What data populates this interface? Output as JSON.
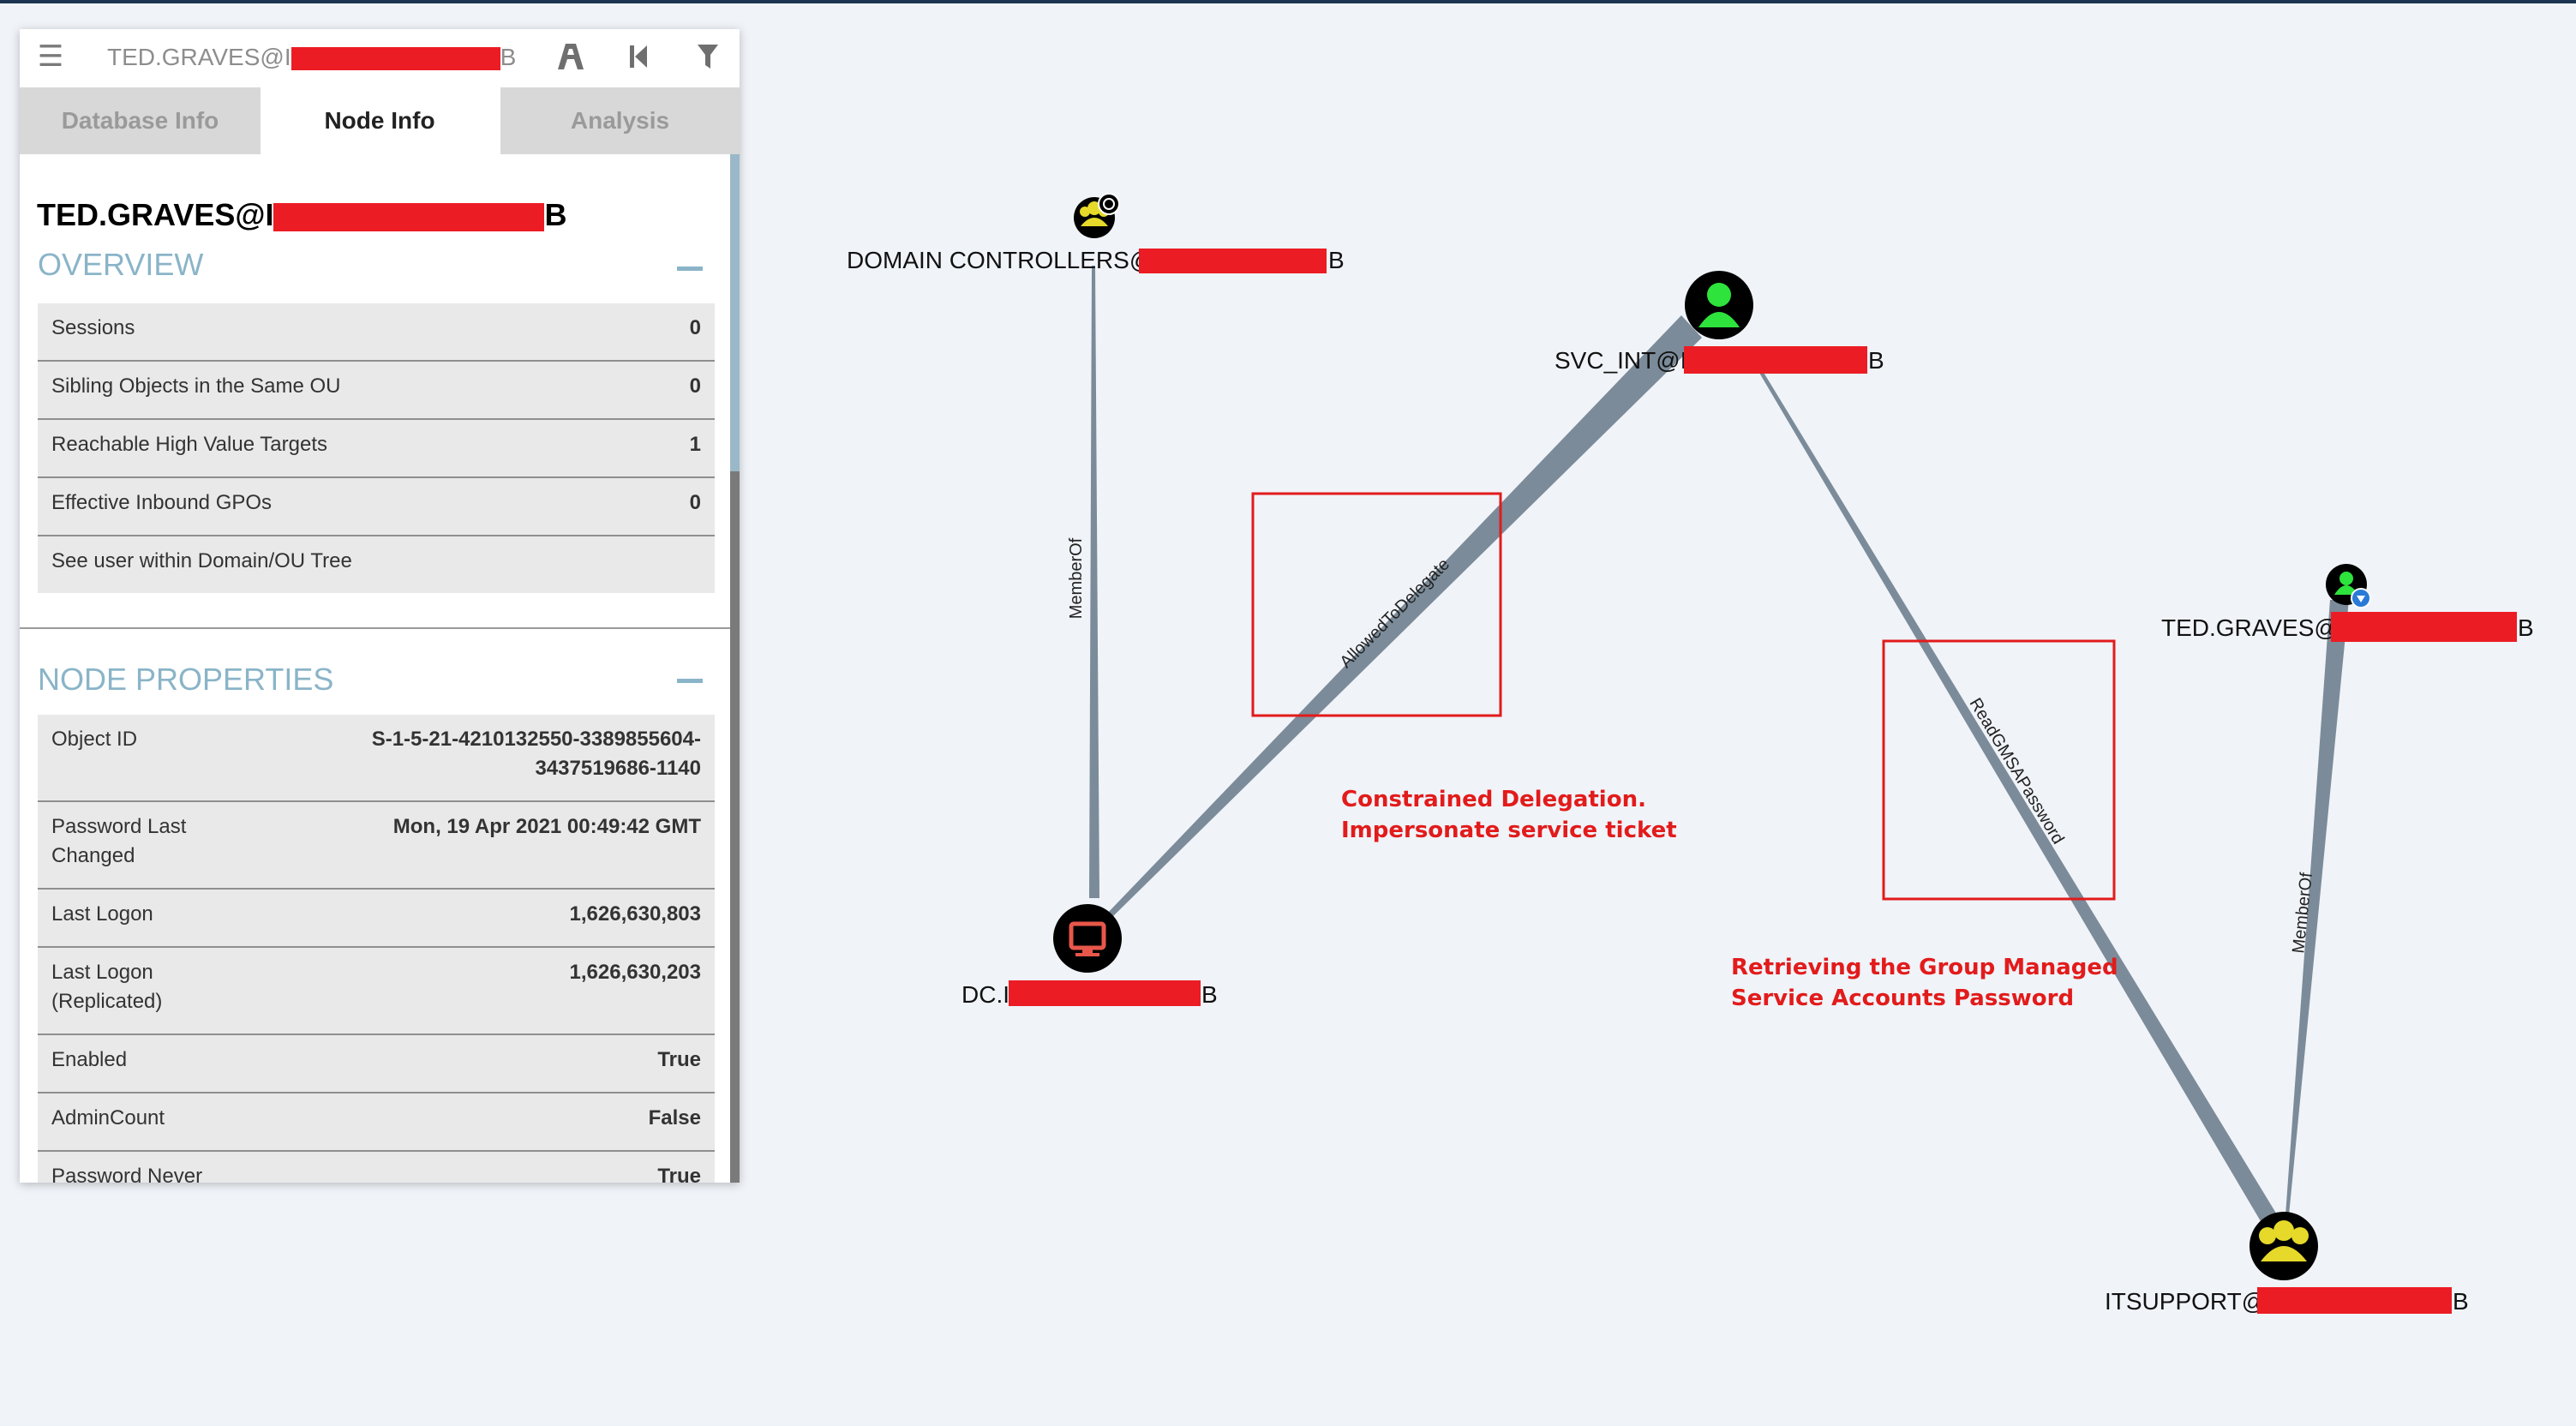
{
  "search": {
    "value": "TED.GRAVES@I",
    "suffix": "B"
  },
  "icons": {
    "menu": "hamburger-menu-icon",
    "pathfinding": "road-pathfinding-icon",
    "back": "skip-back-icon",
    "filter": "funnel-filter-icon"
  },
  "tabs": [
    {
      "label": "Database Info",
      "active": false
    },
    {
      "label": "Node Info",
      "active": true
    },
    {
      "label": "Analysis",
      "active": false
    }
  ],
  "node_info": {
    "title": "TED.GRAVES@I",
    "title_suffix": "B",
    "overview": {
      "heading": "OVERVIEW",
      "rows": [
        {
          "label": "Sessions",
          "value": "0"
        },
        {
          "label": "Sibling Objects in the Same OU",
          "value": "0"
        },
        {
          "label": "Reachable High Value Targets",
          "value": "1"
        },
        {
          "label": "Effective Inbound GPOs",
          "value": "0"
        },
        {
          "label": "See user within Domain/OU Tree",
          "value": ""
        }
      ]
    },
    "properties": {
      "heading": "NODE PROPERTIES",
      "rows": [
        {
          "label": "Object ID",
          "value": "S-1-5-21-4210132550-3389855604-\n3437519686-1140"
        },
        {
          "label": "Password Last\nChanged",
          "value": "Mon, 19 Apr 2021 00:49:42 GMT"
        },
        {
          "label": "Last Logon",
          "value": "1,626,630,803"
        },
        {
          "label": "Last Logon\n(Replicated)",
          "value": "1,626,630,203"
        },
        {
          "label": "Enabled",
          "value": "True"
        },
        {
          "label": "AdminCount",
          "value": "False"
        },
        {
          "label": "Password Never\nExpires",
          "value": "True"
        }
      ]
    }
  },
  "graph": {
    "nodes": {
      "domain_controllers": {
        "label": "DOMAIN CONTROLLERS@I",
        "suffix": "B",
        "type": "group"
      },
      "svc_int": {
        "label": "SVC_INT@I",
        "suffix": "B",
        "type": "user"
      },
      "dc": {
        "label": "DC.I",
        "suffix": "B",
        "type": "computer"
      },
      "ted": {
        "label": "TED.GRAVES@I",
        "suffix": "B",
        "type": "user-owned"
      },
      "itsupport": {
        "label": "ITSUPPORT@I",
        "suffix": "B",
        "type": "group"
      }
    },
    "edges": {
      "dc_memberof": "MemberOf",
      "delegate": "AllowedToDelegate",
      "gmsa": "ReadGMSAPassword",
      "ted_memberof": "MemberOf"
    },
    "annotations": {
      "delegation": [
        "Constrained Delegation.",
        "Impersonate service ticket"
      ],
      "gmsa": [
        "Retrieving the Group Managed",
        "Service Accounts Password"
      ]
    }
  },
  "colors": {
    "redaction": "#ec1c24",
    "accent": "#8ab4c8",
    "edge": "#7b8b99",
    "annotation": "#e21b1b"
  }
}
